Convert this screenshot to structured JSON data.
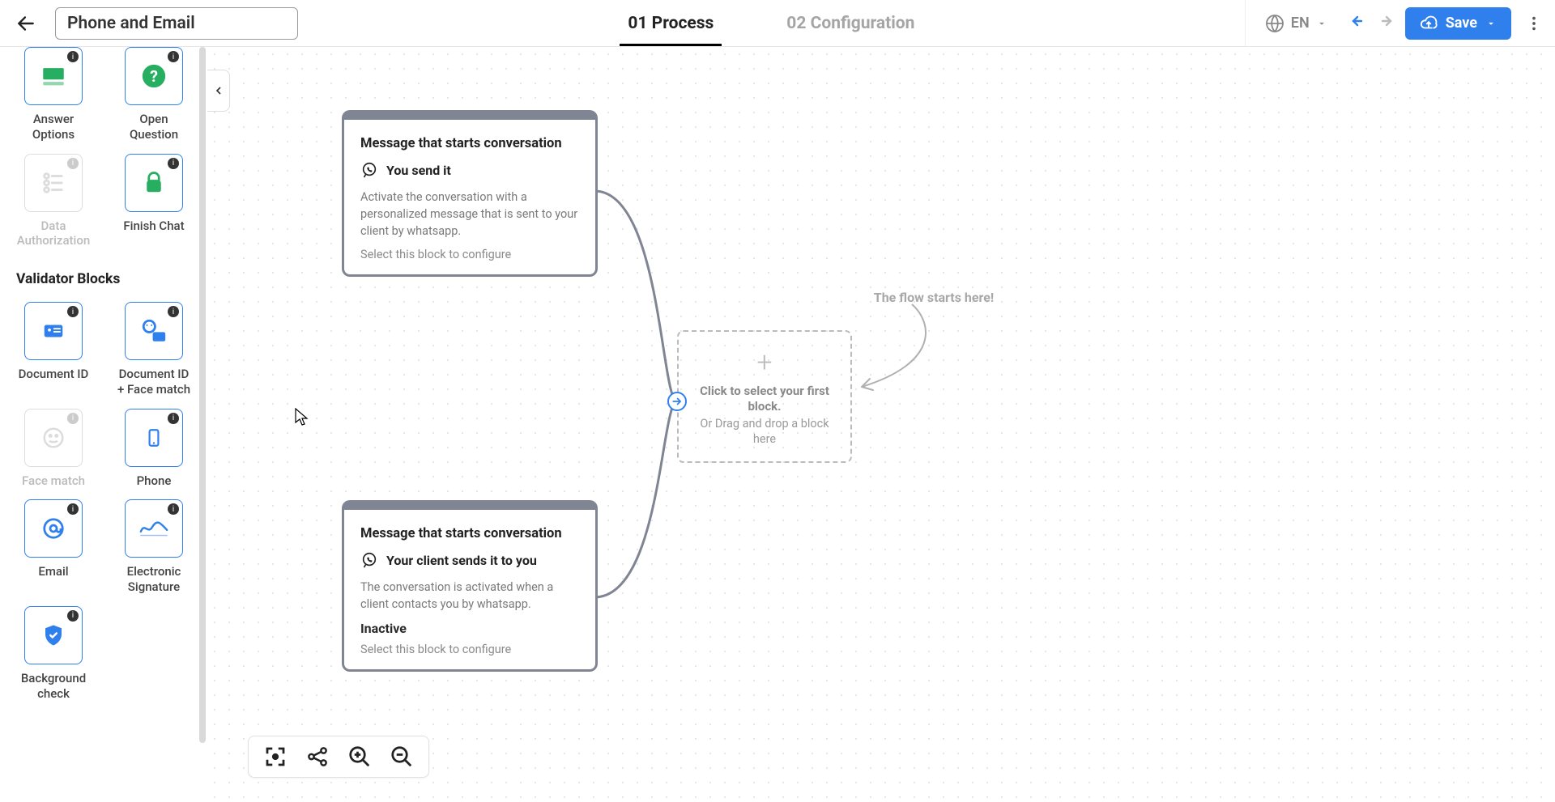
{
  "header": {
    "title_value": "Phone and Email",
    "tabs": {
      "process": "01 Process",
      "config": "02 Configuration"
    },
    "language": "EN",
    "save": "Save"
  },
  "sidebar": {
    "top_blocks": [
      {
        "label": "Answer Options"
      },
      {
        "label": "Open Question"
      },
      {
        "label": "Data Authorization"
      },
      {
        "label": "Finish Chat"
      }
    ],
    "validator_title": "Validator Blocks",
    "validator_blocks": [
      {
        "label": "Document ID"
      },
      {
        "label": "Document ID + Face match"
      },
      {
        "label": "Face match"
      },
      {
        "label": "Phone"
      },
      {
        "label": "Email"
      },
      {
        "label": "Electronic Signature"
      },
      {
        "label": "Background check"
      }
    ]
  },
  "canvas": {
    "card1": {
      "title": "Message that starts conversation",
      "sub": "You send it",
      "desc": "Activate the conversation with a personalized message that is sent to your client by whatsapp.",
      "configure": "Select this block to configure"
    },
    "card2": {
      "title": "Message that starts conversation",
      "sub": "Your client sends it to you",
      "desc": "The conversation is activated when a client contacts you by whatsapp.",
      "inactive": "Inactive",
      "configure": "Select this block to configure"
    },
    "drop": {
      "line1": "Click to select your first block.",
      "line2": "Or Drag and drop a block here"
    },
    "hint": "The flow starts here!"
  }
}
